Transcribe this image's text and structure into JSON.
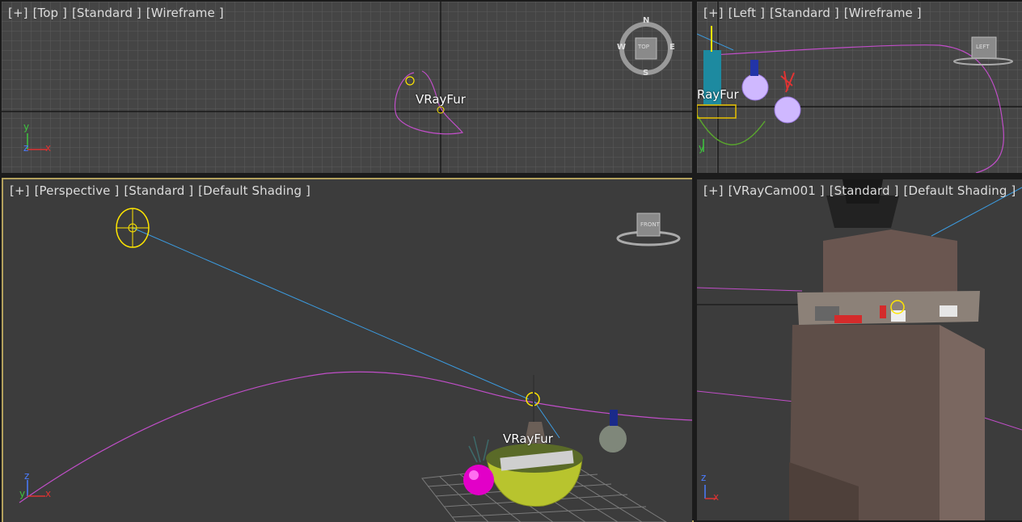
{
  "viewports": {
    "top": {
      "label": {
        "plus": "[+]",
        "view": "[Top ]",
        "preset": "[Standard ]",
        "shading": "[Wireframe ]"
      },
      "object_label": "VRayFur",
      "viewcube": {
        "face": "TOP",
        "n": "N",
        "s": "S",
        "e": "E",
        "w": "W"
      },
      "axis": {
        "y": "y",
        "z": "z",
        "x": "x"
      }
    },
    "left": {
      "label": {
        "plus": "[+]",
        "view": "[Left ]",
        "preset": "[Standard ]",
        "shading": "[Wireframe ]"
      },
      "object_label": "RayFur",
      "viewcube": {
        "face": "LEFT"
      },
      "axis": {
        "y": "y"
      }
    },
    "perspective": {
      "label": {
        "plus": "[+]",
        "view": "[Perspective ]",
        "preset": "[Standard ]",
        "shading": "[Default Shading ]"
      },
      "object_label": "VRayFur",
      "viewcube": {
        "face": "FRONT"
      },
      "axis": {
        "z": "z",
        "y": "y",
        "x": "x"
      }
    },
    "camera": {
      "label": {
        "plus": "[+]",
        "view": "[VRayCam001 ]",
        "preset": "[Standard ]",
        "shading": "[Default Shading ]"
      },
      "axis": {
        "z": "z",
        "x": "x"
      }
    }
  },
  "colors": {
    "active_border": "#b3a15d",
    "viewport_bg": "#444444",
    "grid": "#5a5a5a",
    "spline": "#c04ec8",
    "target_line": "#3b9be0",
    "light": "#ffe600"
  }
}
